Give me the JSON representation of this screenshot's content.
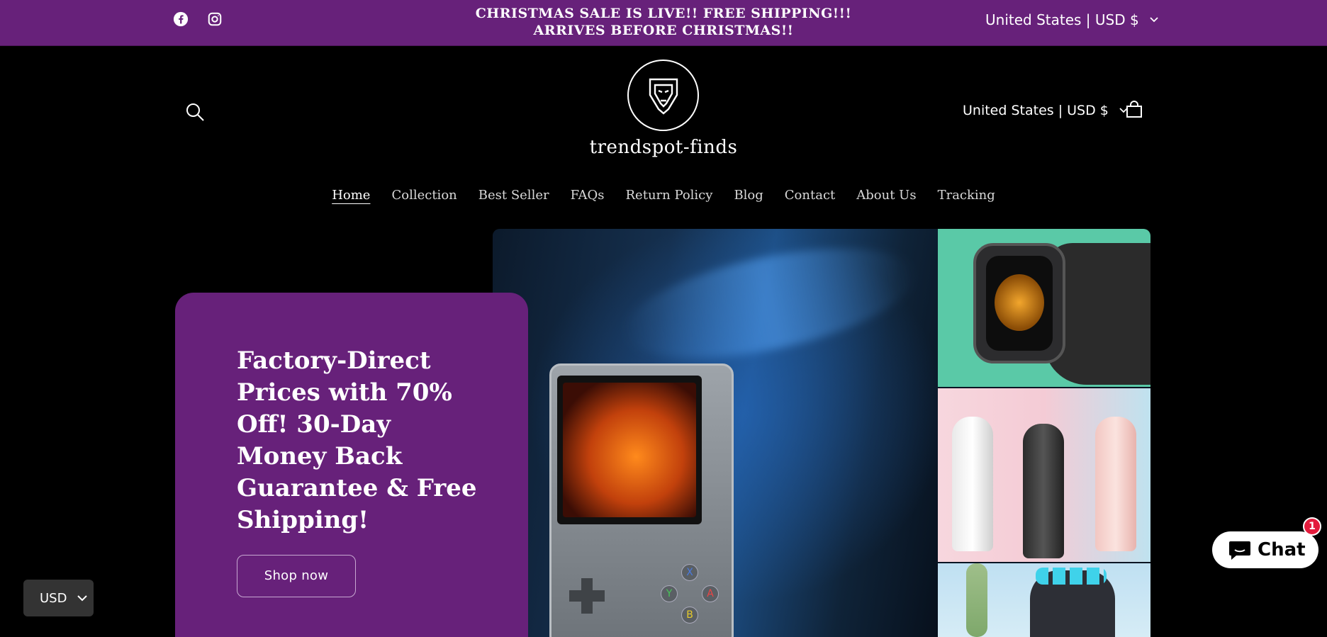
{
  "announcement": {
    "line1": "CHRISTMAS SALE IS LIVE!! FREE SHIPPING!!!",
    "line2": "ARRIVES BEFORE CHRISTMAS!!",
    "currency": "United States | USD $",
    "social": [
      "facebook-icon",
      "instagram-icon"
    ]
  },
  "header": {
    "brand": "trendspot-finds",
    "currency": "United States | USD $"
  },
  "nav": {
    "items": [
      "Home",
      "Collection",
      "Best Seller",
      "FAQs",
      "Return Policy",
      "Blog",
      "Contact",
      "About Us",
      "Tracking"
    ],
    "active": "Home"
  },
  "hero": {
    "title": "Factory-Direct Prices with 70% Off! 30-Day Money Back Guarantee & Free Shipping!",
    "button": "Shop now",
    "console_buttons": [
      "X",
      "Y",
      "A",
      "B"
    ]
  },
  "currency_selector": {
    "value": "USD"
  },
  "chat": {
    "label": "Chat",
    "badge": "1"
  },
  "colors": {
    "accent": "#67217a",
    "background": "#000000",
    "badge": "#e31b3c"
  }
}
